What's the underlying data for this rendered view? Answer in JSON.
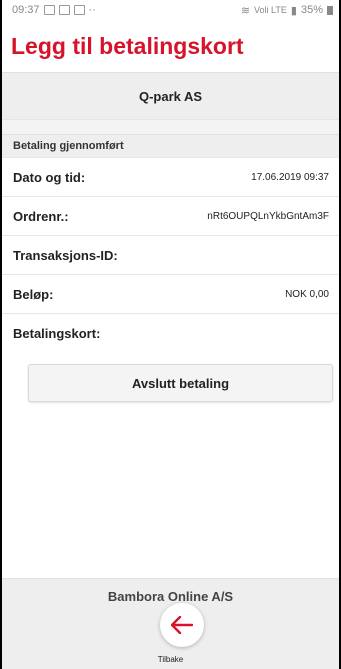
{
  "status_bar": {
    "time": "09:37",
    "signal_text": "Voli LTE",
    "battery": "35%"
  },
  "page": {
    "title": "Legg til betalingskort"
  },
  "merchant": {
    "name": "Q-park AS"
  },
  "section": {
    "header": "Betaling gjennomført"
  },
  "details": {
    "rows": [
      {
        "label": "Dato og tid:",
        "value": "17.06.2019 09:37"
      },
      {
        "label": "Ordrenr.:",
        "value": "nRt6OUPQLnYkbGntAm3F"
      },
      {
        "label": "Transaksjons-ID:",
        "value": ""
      },
      {
        "label": "Beløp:",
        "value": "NOK 0,00"
      },
      {
        "label": "Betalingskort:",
        "value": ""
      }
    ]
  },
  "actions": {
    "finish_label": "Avslutt betaling"
  },
  "footer": {
    "provider": "Bambora Online A/S",
    "back_label": "Tilbake"
  },
  "colors": {
    "accent": "#d6132a"
  }
}
